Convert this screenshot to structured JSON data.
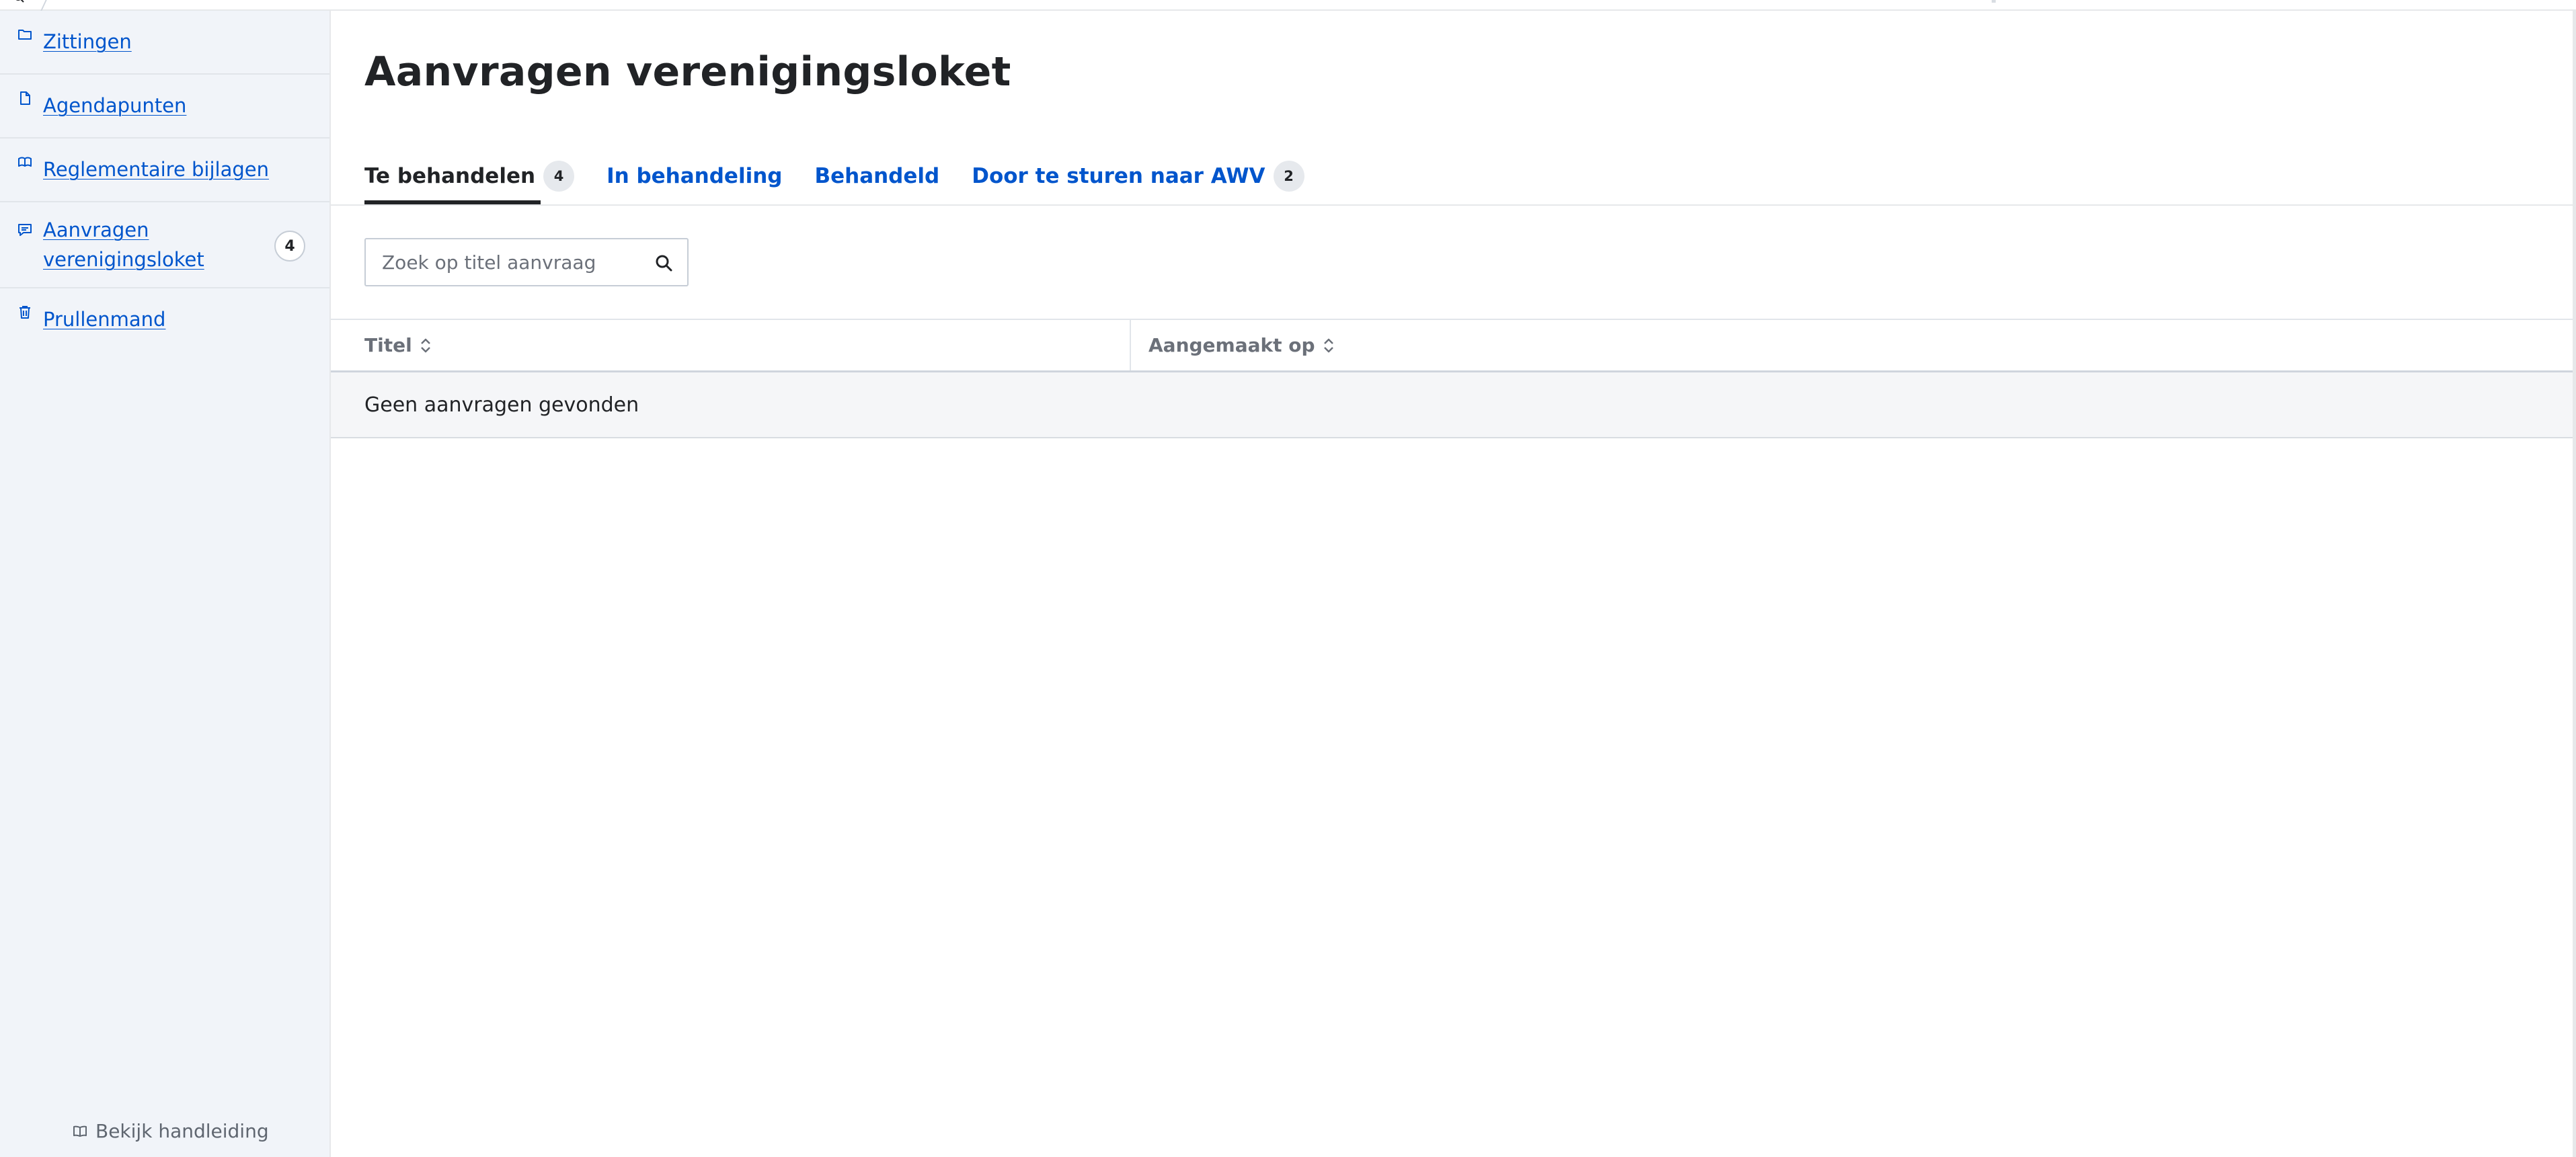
{
  "sidebar": {
    "items": [
      {
        "label": "Zittingen",
        "icon": "folder-icon"
      },
      {
        "label": "Agendapunten",
        "icon": "document-icon"
      },
      {
        "label": "Reglementaire bijlagen",
        "icon": "books-icon"
      },
      {
        "label": "Aanvragen verenigingsloket",
        "icon": "message-icon",
        "badge": "4"
      },
      {
        "label": "Prullenmand",
        "icon": "bin-icon"
      }
    ],
    "manual_label": "Bekijk handleiding"
  },
  "main": {
    "title": "Aanvragen verenigingsloket",
    "tabs": [
      {
        "label": "Te behandelen",
        "badge": "4",
        "active": true
      },
      {
        "label": "In behandeling"
      },
      {
        "label": "Behandeld"
      },
      {
        "label": "Door te sturen naar AWV",
        "badge": "2"
      }
    ],
    "search": {
      "placeholder": "Zoek op titel aanvraag",
      "value": ""
    },
    "table": {
      "columns": [
        "Titel",
        "Aangemaakt op"
      ],
      "empty_message": "Geen aanvragen gevonden"
    }
  },
  "colors": {
    "link": "#0055cc",
    "sidebar_bg": "#f1f4f9",
    "text": "#212326",
    "muted": "#6b7079",
    "tab_underline": "#212326"
  }
}
